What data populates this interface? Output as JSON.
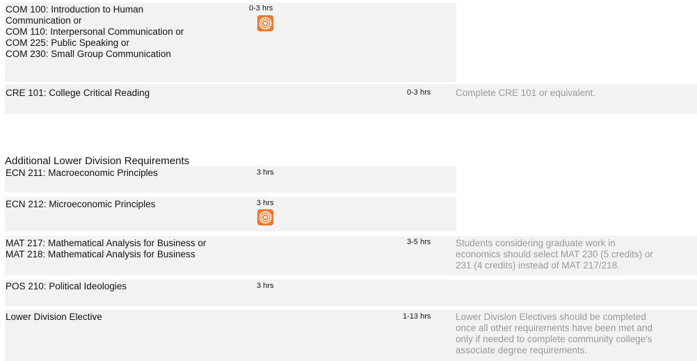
{
  "rows": [
    {
      "course_lines": [
        "COM 100: Introduction to Human",
        "Communication or",
        "COM 110: Interpersonal Communication or",
        "COM 225: Public Speaking or",
        "COM 230: Small Group Communication"
      ],
      "hours": "0-3 hrs"
    },
    {
      "course_lines": [
        "CRE 101: College Critical Reading"
      ],
      "hours": "0-3 hrs",
      "note_lines": [
        "Complete CRE 101 or equivalent."
      ]
    }
  ],
  "section_title": "Additional Lower Division Requirements",
  "additional_rows": [
    {
      "course_lines": [
        "ECN 211: Macroeconomic Principles"
      ],
      "hours": "3 hrs"
    },
    {
      "course_lines": [
        "ECN 212: Microeconomic Principles"
      ],
      "hours": "3 hrs"
    },
    {
      "course_lines": [
        "MAT 217: Mathematical Analysis for Business or",
        "MAT 218: Mathematical Analysis for Business"
      ],
      "hours": "3-5 hrs",
      "note_lines": [
        "Students considering graduate work in",
        "economics should select MAT 230 (5 credits) or",
        "231 (4 credits) instead of MAT 217/218."
      ]
    },
    {
      "course_lines": [
        "POS 210: Political Ideologies"
      ],
      "hours": "3 hrs"
    },
    {
      "course_lines": [
        "Lower Division Elective"
      ],
      "hours": "1-13 hrs",
      "note_lines": [
        "Lower Division Electives should be completed",
        "once all other requirements have been met and",
        "only if needed to complete community college's",
        "associate degree requirements."
      ]
    }
  ],
  "icons": {
    "gen_studies": "target-circle-icon",
    "color": "#f07a2e"
  }
}
